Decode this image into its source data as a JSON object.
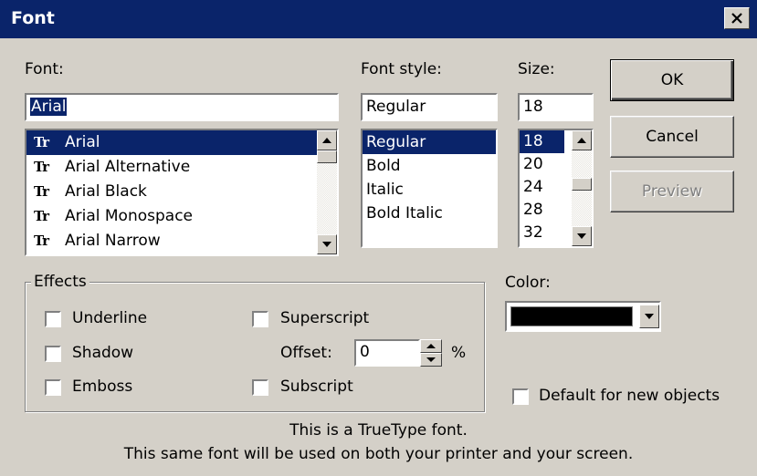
{
  "window": {
    "title": "Font",
    "close_icon": "close-icon"
  },
  "font": {
    "label": "Font:",
    "value": "Arial",
    "items": [
      "Arial",
      "Arial Alternative",
      "Arial Black",
      "Arial Monospace",
      "Arial Narrow"
    ],
    "selected": "Arial",
    "truetype_glyph": "Tr"
  },
  "font_style": {
    "label": "Font style:",
    "value": "Regular",
    "items": [
      "Regular",
      "Bold",
      "Italic",
      "Bold Italic"
    ],
    "selected": "Regular"
  },
  "size": {
    "label": "Size:",
    "value": "18",
    "items": [
      "18",
      "20",
      "24",
      "28",
      "32"
    ],
    "selected": "18"
  },
  "buttons": {
    "ok": "OK",
    "cancel": "Cancel",
    "preview": "Preview"
  },
  "effects": {
    "legend": "Effects",
    "underline": "Underline",
    "shadow": "Shadow",
    "emboss": "Emboss",
    "superscript": "Superscript",
    "offset_label": "Offset:",
    "offset_value": "0",
    "percent": "%",
    "subscript": "Subscript"
  },
  "color": {
    "label": "Color:",
    "value": "#000000"
  },
  "default_for_new": "Default for new objects",
  "info": {
    "line1": "This is a TrueType font.",
    "line2": "This same font will be used on both your printer and your screen."
  }
}
